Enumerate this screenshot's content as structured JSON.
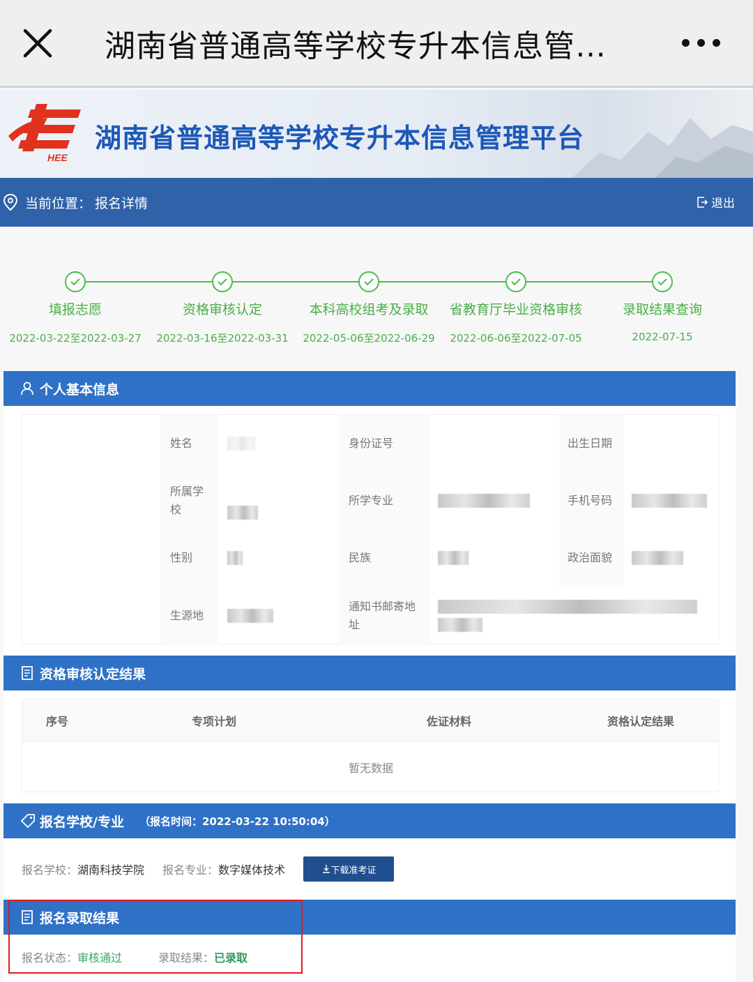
{
  "topbar": {
    "title": "湖南省普通高等学校专升本信息管…"
  },
  "banner": {
    "site_title": "湖南省普通高等学校专升本信息管理平台",
    "logo_text": "HEE"
  },
  "location": {
    "label": "当前位置：",
    "value": "报名详情",
    "logout": "退出"
  },
  "steps": [
    {
      "label": "填报志愿",
      "date": "2022-03-22至2022-03-27"
    },
    {
      "label": "资格审核认定",
      "date": "2022-03-16至2022-03-31"
    },
    {
      "label": "本科高校组考及录取",
      "date": "2022-05-06至2022-06-29"
    },
    {
      "label": "省教育厅毕业资格审核",
      "date": "2022-06-06至2022-07-05"
    },
    {
      "label": "录取结果查询",
      "date": "2022-07-15"
    }
  ],
  "personal": {
    "title": "个人基本信息",
    "labels": {
      "name": "姓名",
      "id_number": "身份证号",
      "birth": "出生日期",
      "school": "所属学校",
      "major": "所学专业",
      "phone": "手机号码",
      "gender": "性别",
      "ethnicity": "民族",
      "politics": "政治面貌",
      "origin": "生源地",
      "address": "通知书邮寄地址"
    }
  },
  "qualification": {
    "title": "资格审核认定结果",
    "headers": [
      "序号",
      "专项计划",
      "佐证材料",
      "资格认定结果"
    ],
    "empty": "暂无数据"
  },
  "application": {
    "title": "报名学校/专业",
    "time_note": "（报名时间：2022-03-22 10:50:04）",
    "school_label": "报名学校：",
    "school_value": "湖南科技学院",
    "major_label": "报名专业：",
    "major_value": "数字媒体技术",
    "download_button": "下载准考证"
  },
  "result": {
    "title": "报名录取结果",
    "status_label": "报名状态：",
    "status_value": "审核通过",
    "admission_label": "录取结果：",
    "admission_value": "已录取"
  },
  "colors": {
    "accent": "#2f71c6",
    "location_bar": "#2f62a8",
    "step_green": "#4cbb4c",
    "highlight": "#e01b1b"
  }
}
